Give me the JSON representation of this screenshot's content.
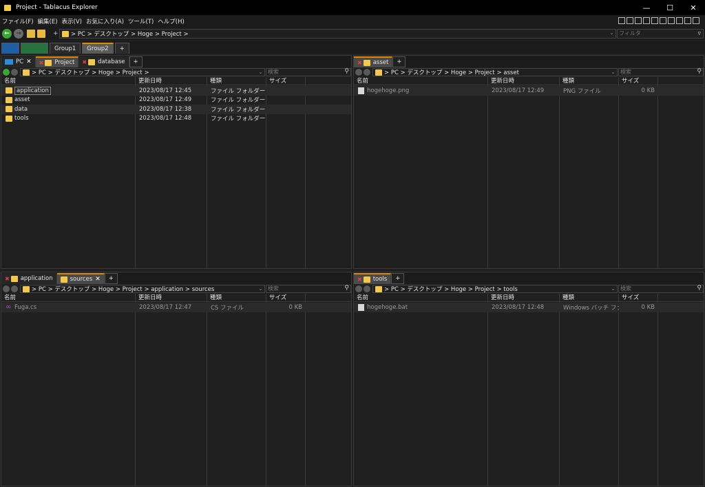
{
  "window": {
    "title": "Project - Tablacus Explorer",
    "controls": [
      "—",
      "☐",
      "✕"
    ]
  },
  "menu": [
    "ファイル(F)",
    "編集(E)",
    "表示(V)",
    "お気に入り(A)",
    "ツール(T)",
    "ヘルプ(H)"
  ],
  "toolbar": {
    "address": "> PC > デスクトップ > Hoge > Project >",
    "filter_placeholder": "フィルタ"
  },
  "groups": [
    {
      "label": "",
      "kind": "color-blue"
    },
    {
      "label": "",
      "kind": "color-green"
    },
    {
      "label": "Group1"
    },
    {
      "label": "Group2",
      "active": true
    },
    {
      "label": "+"
    }
  ],
  "columns": {
    "name": "名前",
    "date": "更新日時",
    "type": "種類",
    "size": "サイズ"
  },
  "search_placeholder": "検索",
  "panes": {
    "top_left": {
      "tabs": [
        {
          "label": "PC",
          "icon": "pc",
          "close": "✕"
        },
        {
          "label": "Project",
          "icon": "folder",
          "pinned": true,
          "active": true
        },
        {
          "label": "database",
          "icon": "folder",
          "pinned": true
        },
        {
          "label": "+"
        }
      ],
      "address": "> PC > デスクトップ > Hoge > Project >",
      "rows": [
        {
          "name": "application",
          "date": "2023/08/17 12:45",
          "type": "ファイル フォルダー",
          "size": ""
        },
        {
          "name": "asset",
          "date": "2023/08/17 12:49",
          "type": "ファイル フォルダー",
          "size": ""
        },
        {
          "name": "data",
          "date": "2023/08/17 12:38",
          "type": "ファイル フォルダー",
          "size": ""
        },
        {
          "name": "tools",
          "date": "2023/08/17 12:48",
          "type": "ファイル フォルダー",
          "size": ""
        }
      ]
    },
    "top_right": {
      "tabs": [
        {
          "label": "asset",
          "icon": "folder",
          "pinned": true,
          "active": true
        },
        {
          "label": "+"
        }
      ],
      "address": "> PC > デスクトップ > Hoge > Project > asset",
      "rows": [
        {
          "name": "hogehoge.png",
          "date": "2023/08/17 12:49",
          "type": "PNG ファイル",
          "size": "0 KB"
        }
      ]
    },
    "bottom_left": {
      "tabs": [
        {
          "label": "application",
          "icon": "folder",
          "pinned": true
        },
        {
          "label": "sources",
          "icon": "folder",
          "active": true,
          "close": "✕"
        },
        {
          "label": "+"
        }
      ],
      "address": "> PC > デスクトップ > Hoge > Project > application > sources",
      "rows": [
        {
          "name": "Fuga.cs",
          "date": "2023/08/17 12:47",
          "type": "CS ファイル",
          "size": "0 KB"
        }
      ]
    },
    "bottom_right": {
      "tabs": [
        {
          "label": "tools",
          "icon": "folder",
          "pinned": true,
          "active": true
        },
        {
          "label": "+"
        }
      ],
      "address": "> PC > デスクトップ > Hoge > Project > tools",
      "rows": [
        {
          "name": "hogehoge.bat",
          "date": "2023/08/17 12:48",
          "type": "Windows バッチ ファ...",
          "size": "0 KB"
        }
      ]
    }
  },
  "colors": {
    "accent": "#e08a00",
    "folder": "#f2c94c",
    "background": "#202020"
  }
}
